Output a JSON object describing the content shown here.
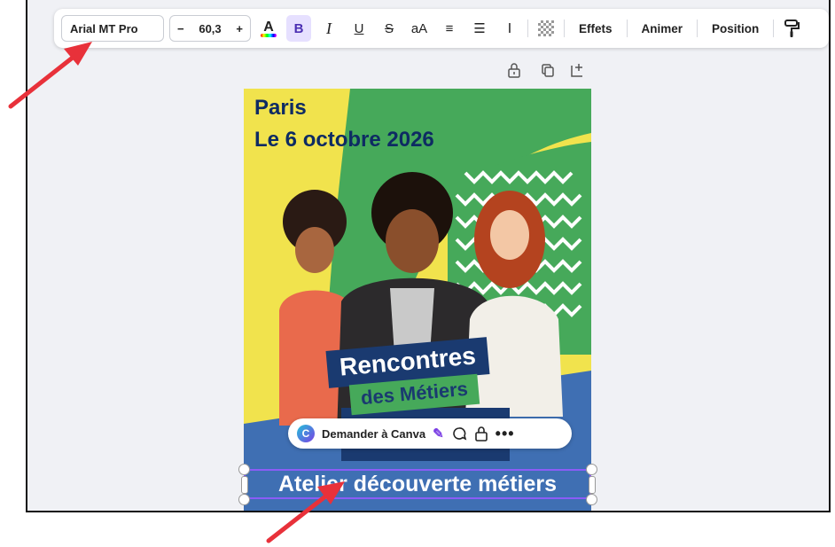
{
  "toolbar": {
    "font_name": "Arial MT Pro",
    "size_minus": "−",
    "font_size": "60,3",
    "size_plus": "+",
    "text_color": "A",
    "bold": "B",
    "italic": "I",
    "underline": "U",
    "strike": "S",
    "case": "aA",
    "align": "≡",
    "list": "☰",
    "spacing": "Ⅰ",
    "effects": "Effets",
    "animate": "Animer",
    "position": "Position",
    "accent_color": "#e6e0ff"
  },
  "poster": {
    "city": "Paris",
    "date": "Le 6 octobre 2026",
    "title_line1": "Rencontres",
    "title_line2": "des Métiers",
    "subtitle": "Atelier découverte métiers"
  },
  "ask_bar": {
    "label": "Demander à Canva"
  },
  "colors": {
    "yellow": "#f1e34d",
    "green": "#46a95a",
    "navy": "#1a3a70",
    "blue": "#3f6fb3",
    "arrow": "#e8313a"
  }
}
